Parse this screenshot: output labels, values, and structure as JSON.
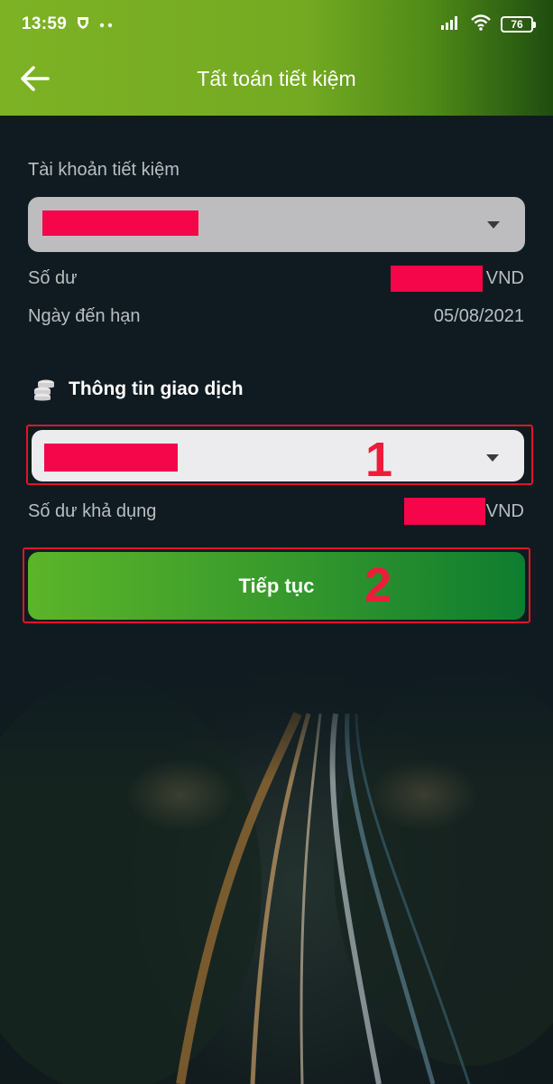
{
  "status_bar": {
    "time": "13:59",
    "battery": "76"
  },
  "nav": {
    "title": "Tất toán tiết kiệm"
  },
  "savings": {
    "account_label": "Tài khoản tiết kiệm",
    "balance_label": "Số dư",
    "balance_currency": "VND",
    "due_date_label": "Ngày đến hạn",
    "due_date_value": "05/08/2021"
  },
  "transaction": {
    "section_title": "Thông tin giao dịch",
    "available_label": "Số dư khả dụng",
    "available_currency": "VND"
  },
  "actions": {
    "continue_label": "Tiếp tục"
  },
  "annotations": {
    "marker_1": "1",
    "marker_2": "2"
  },
  "colors": {
    "header_green": "#7db225",
    "redaction": "#f5054a",
    "annotation_red": "#e0142a",
    "button_green_start": "#5cb42a",
    "button_green_end": "#0f7d30"
  }
}
